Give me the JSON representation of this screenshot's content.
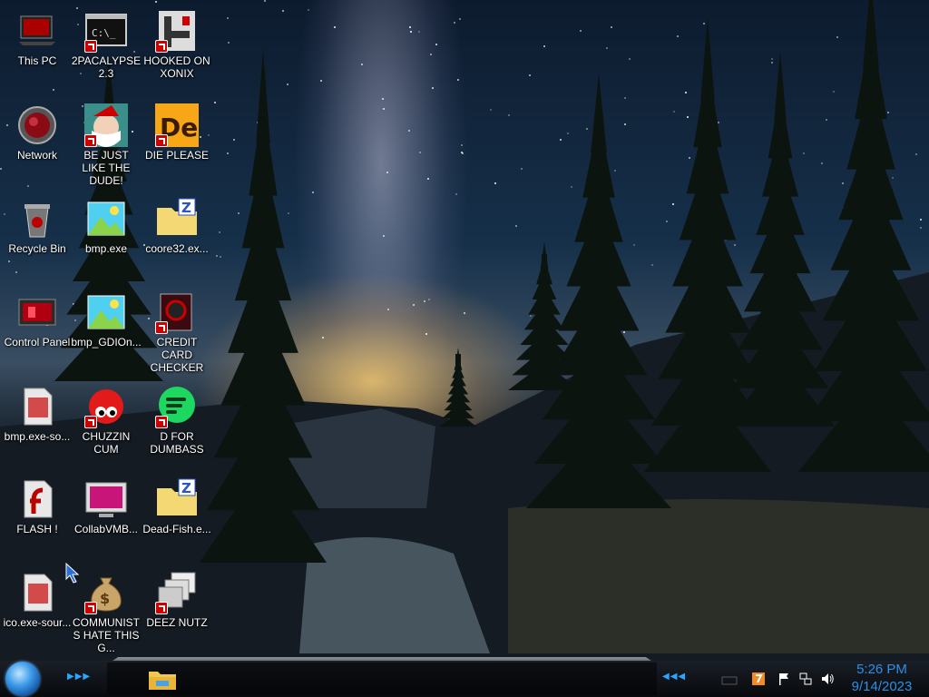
{
  "desktop": {
    "icons": [
      {
        "label": "This PC",
        "icon": "computer-icon"
      },
      {
        "label": "2PACALYPSE 2.3",
        "icon": "terminal-icon"
      },
      {
        "label": "HOOKED ON XONIX",
        "icon": "xonix-icon"
      },
      {
        "label": "Network",
        "icon": "network-globe-icon"
      },
      {
        "label": "BE JUST LIKE THE DUDE!",
        "icon": "santa-icon"
      },
      {
        "label": "DIE PLEASE",
        "icon": "de-icon"
      },
      {
        "label": "Recycle Bin",
        "icon": "recycle-bin-icon"
      },
      {
        "label": "bmp.exe",
        "icon": "image-icon"
      },
      {
        "label": "coore32.ex...",
        "icon": "zip-folder-icon"
      },
      {
        "label": "Control Panel",
        "icon": "control-panel-icon"
      },
      {
        "label": "bmp_GDIOn...",
        "icon": "image-icon"
      },
      {
        "label": "CREDIT CARD CHECKER",
        "icon": "graphics-card-icon"
      },
      {
        "label": "bmp.exe-so...",
        "icon": "file-icon"
      },
      {
        "label": "CHUZZIN CUM",
        "icon": "chuzzle-icon"
      },
      {
        "label": "D FOR DUMBASS",
        "icon": "spotify-icon"
      },
      {
        "label": "FLASH !",
        "icon": "flash-icon"
      },
      {
        "label": "CollabVMB...",
        "icon": "monitor-icon"
      },
      {
        "label": "Dead-Fish.e...",
        "icon": "zip-folder-icon"
      },
      {
        "label": "ico.exe-sour...",
        "icon": "file-icon"
      },
      {
        "label": "COMMUNISTS HATE THIS G...",
        "icon": "money-bag-icon"
      },
      {
        "label": "DEEZ NUTZ",
        "icon": "windows-stack-icon"
      }
    ]
  },
  "taskbar": {
    "start_button": "start-orb-icon",
    "pinned": [
      {
        "name": "file-explorer-icon"
      }
    ],
    "tray": [
      "notification-icon",
      "flag-icon",
      "network-icon",
      "volume-icon"
    ],
    "clock": {
      "time": "5:26 PM",
      "date": "9/14/2023"
    },
    "accent_color": "#2e8fe6"
  }
}
